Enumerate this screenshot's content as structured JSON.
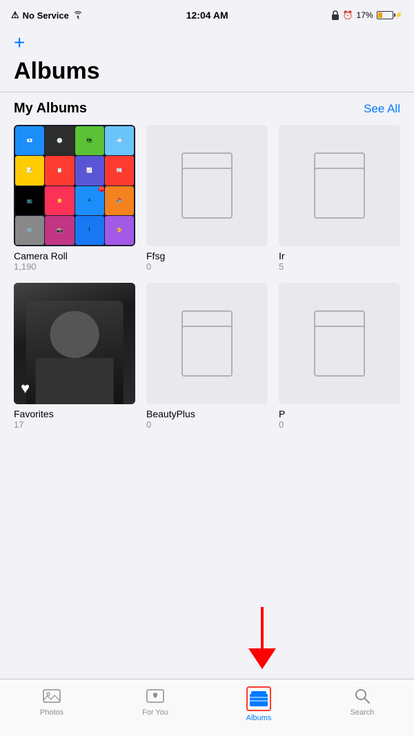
{
  "statusBar": {
    "noService": "No Service",
    "time": "12:04 AM",
    "battery": "17%"
  },
  "nav": {
    "addButton": "+",
    "pageTitle": "Albums"
  },
  "myAlbums": {
    "sectionTitle": "My Albums",
    "seeAll": "See All",
    "albums": [
      {
        "name": "Camera Roll",
        "count": "1,190",
        "hasImage": true,
        "type": "camera-roll"
      },
      {
        "name": "Ffsg",
        "count": "0",
        "hasImage": false,
        "type": "empty"
      },
      {
        "name": "Ir",
        "count": "5",
        "hasImage": false,
        "type": "partial"
      },
      {
        "name": "Favorites",
        "count": "17",
        "hasImage": true,
        "type": "favorites"
      },
      {
        "name": "BeautyPlus",
        "count": "0",
        "hasImage": false,
        "type": "empty"
      },
      {
        "name": "P",
        "count": "0",
        "hasImage": false,
        "type": "partial"
      }
    ]
  },
  "tabBar": {
    "tabs": [
      {
        "id": "photos",
        "label": "Photos",
        "active": false
      },
      {
        "id": "for-you",
        "label": "For You",
        "active": false
      },
      {
        "id": "albums",
        "label": "Albums",
        "active": true
      },
      {
        "id": "search",
        "label": "Search",
        "active": false
      }
    ]
  }
}
